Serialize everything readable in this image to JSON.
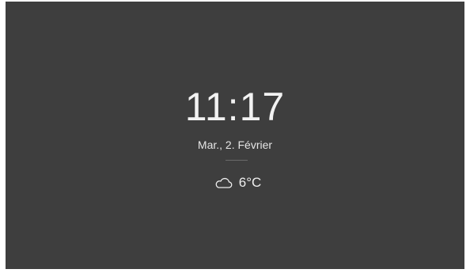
{
  "clock": {
    "time": "11:17"
  },
  "date": {
    "text": "Mar., 2. Février"
  },
  "weather": {
    "icon": "cloud-icon",
    "temperature": "6°C"
  },
  "colors": {
    "background": "#3e3e3e",
    "text": "#f2f2f2",
    "divider": "#6a6a6a"
  }
}
